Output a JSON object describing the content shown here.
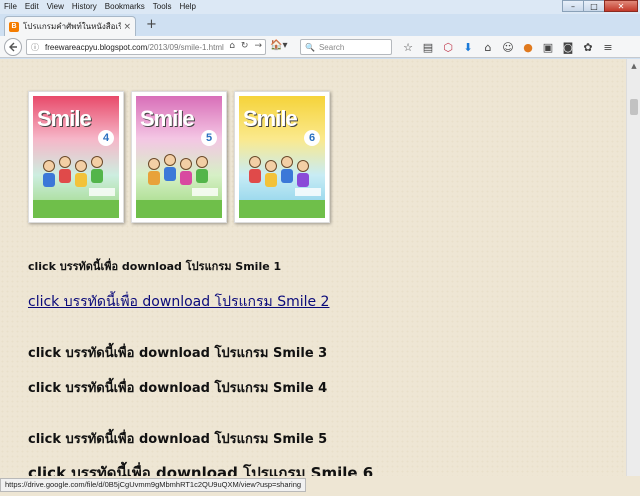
{
  "menubar": {
    "items": [
      "File",
      "Edit",
      "View",
      "History",
      "Bookmarks",
      "Tools",
      "Help"
    ]
  },
  "window_controls": {
    "minimize": "–",
    "maximize": "□",
    "close": "✕"
  },
  "tab": {
    "title": "โปรแกรมคำศัพท์ในหนังสือเรี...",
    "favicon_letter": "B",
    "close": "×",
    "new_tab": "+"
  },
  "navbar": {
    "url_host": "freewareacpyu.blogspot.com",
    "url_path": "/2013/09/smile-1.html",
    "search_placeholder": "Search",
    "icons": [
      "star-icon",
      "reading-list-icon",
      "pocket-icon",
      "download-icon",
      "home-icon",
      "smiley-icon",
      "basketball-icon",
      "save-icon",
      "camera-icon",
      "addon-icon",
      "menu-icon"
    ]
  },
  "covers": [
    {
      "word": "Smile",
      "number": "4",
      "accent": "#e84a6a"
    },
    {
      "word": "Smile",
      "number": "5",
      "accent": "#d86fb8"
    },
    {
      "word": "Smile",
      "number": "6",
      "accent": "#f5d33a"
    }
  ],
  "links": {
    "line1": "click บรรทัดนี้เพื่อ download โปรแกรม Smile 1",
    "line2": "click บรรทัดนี้เพื่อ download โปรแกรม Smile 2",
    "line3": "click บรรทัดนี้เพื่อ download โปรแกรม Smile 3",
    "line4": "click บรรทัดนี้เพื่อ download โปรแกรม Smile 4",
    "line5": "click บรรทัดนี้เพื่อ download โปรแกรม Smile 5",
    "line6": "click บรรทัดนี้เพื่อ download โปรแกรม Smile 6"
  },
  "status": {
    "link_url": "https://drive.google.com/file/d/0B5jCgUvmm9gMbmhRT1c2QU9uQXM/view?usp=sharing"
  }
}
